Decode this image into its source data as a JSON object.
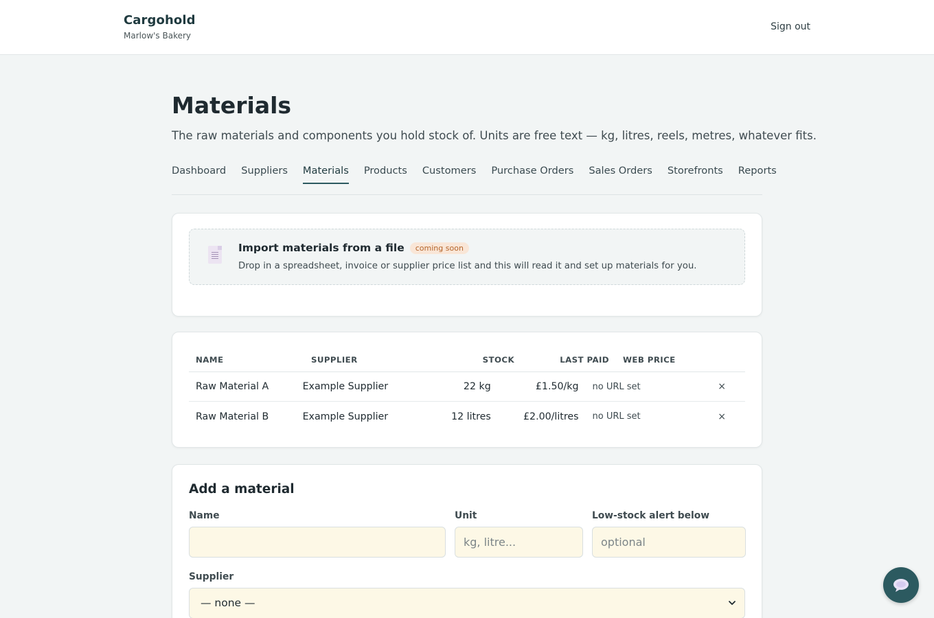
{
  "brand": {
    "name": "Cargohold",
    "subtitle": "Marlow's Bakery"
  },
  "header": {
    "signout_label": "Sign out"
  },
  "page": {
    "title": "Materials",
    "description": "The raw materials and components you hold stock of. Units are free text — kg, litres, reels, metres, whatever fits."
  },
  "tabs": [
    {
      "label": "Dashboard"
    },
    {
      "label": "Suppliers"
    },
    {
      "label": "Materials"
    },
    {
      "label": "Products"
    },
    {
      "label": "Customers"
    },
    {
      "label": "Purchase Orders"
    },
    {
      "label": "Sales Orders"
    },
    {
      "label": "Storefronts"
    },
    {
      "label": "Reports"
    }
  ],
  "active_tab": "Materials",
  "import": {
    "title": "Import materials from a file",
    "badge": "coming soon",
    "description": "Drop in a spreadsheet, invoice or supplier price list and this will read it and set up materials for you."
  },
  "table": {
    "headers": {
      "name": "NAME",
      "supplier": "SUPPLIER",
      "stock": "STOCK",
      "last_paid": "LAST PAID",
      "web_price": "WEB PRICE"
    },
    "rows": [
      {
        "name": "Raw Material A",
        "supplier": "Example Supplier",
        "stock": "22 kg",
        "last_paid": "£1.50/kg",
        "web_price": "no URL set",
        "delete": "×"
      },
      {
        "name": "Raw Material B",
        "supplier": "Example Supplier",
        "stock": "12 litres",
        "last_paid": "£2.00/litres",
        "web_price": "no URL set",
        "delete": "×"
      }
    ]
  },
  "add_form": {
    "title": "Add a material",
    "name_label": "Name",
    "name_value": "",
    "unit_label": "Unit",
    "unit_placeholder": "kg, litre...",
    "low_label": "Low-stock alert below",
    "low_placeholder": "optional",
    "supplier_label": "Supplier",
    "supplier_selected": "— none —"
  },
  "icons": {
    "import": "document-icon",
    "chat": "chat-bubble-icon",
    "select": "chevron-down-icon"
  },
  "colors": {
    "accent": "#2c5a60",
    "input_bg": "#fdf8e6",
    "badge_bg": "#f9e6d7",
    "badge_text": "#b5652b"
  }
}
